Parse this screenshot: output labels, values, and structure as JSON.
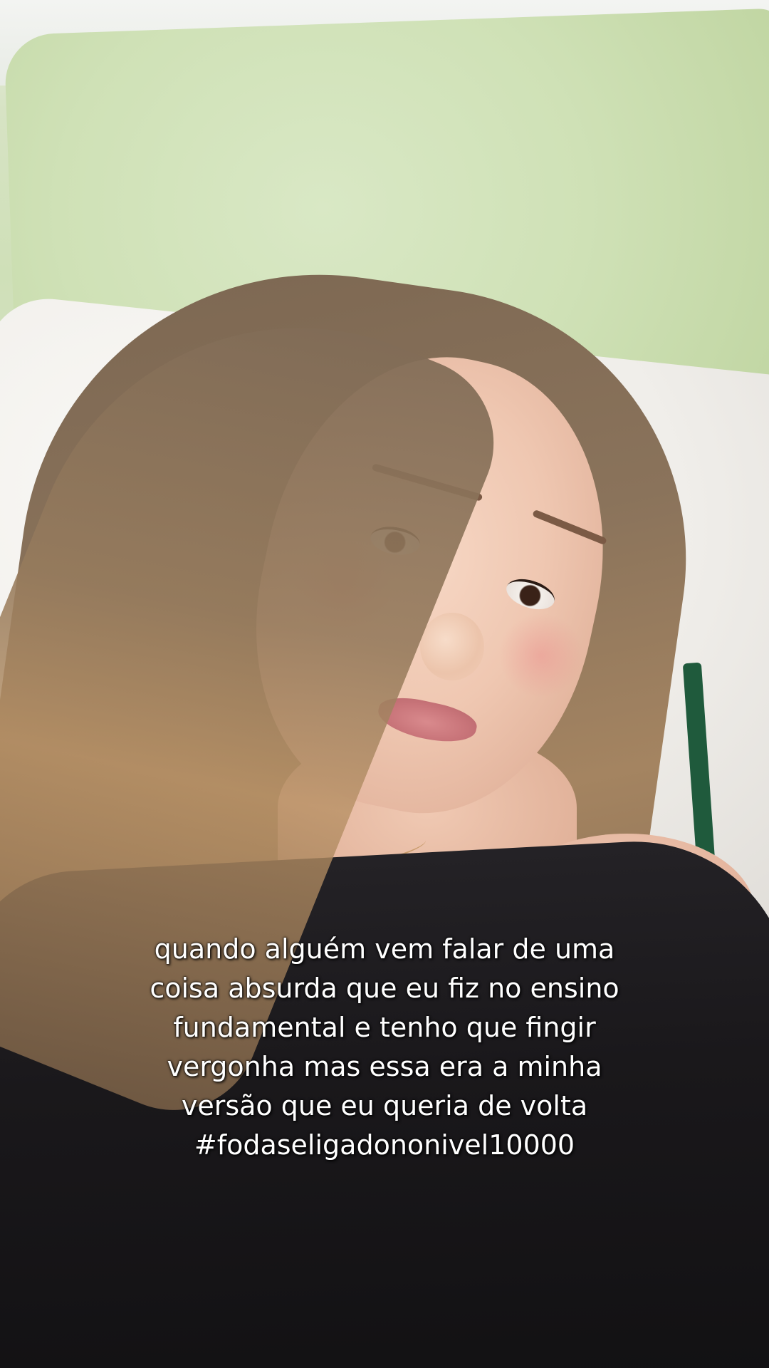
{
  "caption": {
    "lines": [
      "quando alguém vem falar de uma",
      "coisa absurda que eu fiz no ensino",
      "fundamental e tenho que fingir",
      "vergonha mas essa era a minha",
      "versão que eu queria de volta",
      "#fodaseligadononivel10000"
    ]
  },
  "colors": {
    "green_pillow": "#cfe1b6",
    "white_pillow": "#f0eeea",
    "pillow_stripe": "#1f5a3c",
    "shirt": "#1a181b",
    "hair": "#8a735b",
    "caption_text": "#ffffff"
  }
}
